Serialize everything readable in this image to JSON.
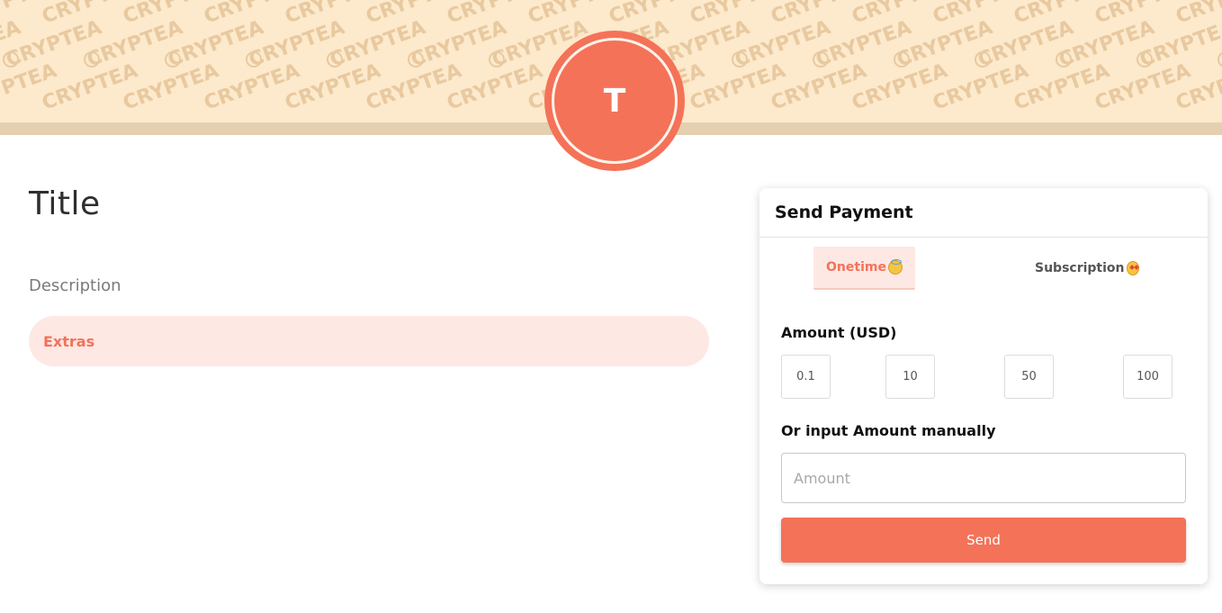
{
  "banner": {
    "pattern_text": "CRYPTEA",
    "colors": {
      "background": "#fde9cb",
      "strip": "#e4cfb1",
      "pattern": "#e8c9a0"
    }
  },
  "avatar": {
    "initial": "T",
    "color": "#f47258"
  },
  "profile": {
    "title": "Title",
    "description": "Description",
    "extras_label": "Extras"
  },
  "payment": {
    "header": "Send Payment",
    "tabs": [
      {
        "label": "Onetime",
        "icon": "halo-smile-emoji",
        "active": true
      },
      {
        "label": "Subscription",
        "icon": "star-struck-emoji",
        "active": false
      }
    ],
    "amount_label": "Amount (USD)",
    "presets": [
      "0.1",
      "10",
      "50",
      "100"
    ],
    "manual_label": "Or input Amount manually",
    "amount_placeholder": "Amount",
    "amount_value": "",
    "send_label": "Send",
    "accent": "#f47258"
  }
}
